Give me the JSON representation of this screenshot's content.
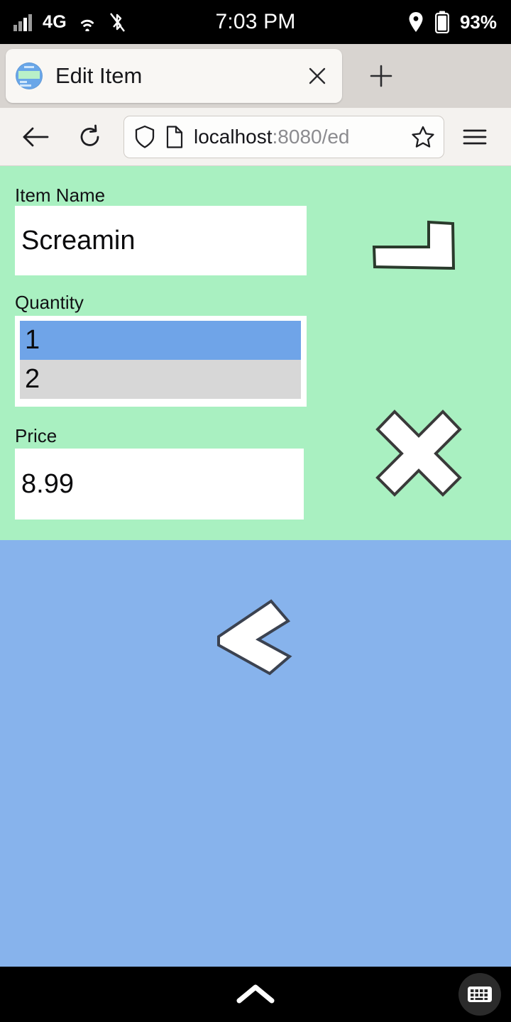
{
  "status_bar": {
    "network_label": "4G",
    "time": "7:03 PM",
    "battery_percent": "93%",
    "icons": [
      "signal-bars-icon",
      "wifi-icon",
      "bluetooth-off-icon",
      "location-pin-icon",
      "battery-icon"
    ]
  },
  "browser": {
    "tab": {
      "title": "Edit Item",
      "favicon": "page-thumbnail-favicon",
      "close_label": "×"
    },
    "new_tab_label": "+",
    "toolbar": {
      "back_icon": "arrow-left-icon",
      "reload_icon": "reload-icon",
      "shield_icon": "shield-icon",
      "page_icon": "page-document-icon",
      "bookmark_icon": "star-icon",
      "menu_icon": "hamburger-menu-icon"
    },
    "url": {
      "host": "localhost",
      "rest": ":8080/ed",
      "full_visible": "localhost:8080/ed"
    }
  },
  "page": {
    "background_top_color": "#a9f0c1",
    "background_bottom_color": "#87b3ec",
    "fields": [
      {
        "label": "Item Name",
        "value": "Screamin",
        "type": "text"
      },
      {
        "label": "Quantity",
        "value": "1",
        "type": "select"
      },
      {
        "label": "Price",
        "value": "8.99",
        "type": "text"
      }
    ],
    "quantity_options": [
      {
        "label": "1",
        "selected": true
      },
      {
        "label": "2",
        "selected": false
      }
    ],
    "shapes": [
      {
        "name": "l-block-shape",
        "fill": "#ffffff",
        "stroke": "#2a3a2c"
      },
      {
        "name": "cross-shape",
        "fill": "#ffffff",
        "stroke": "#3a3a3a"
      },
      {
        "name": "left-chevron-shape",
        "fill": "#ffffff",
        "stroke": "#3b4250"
      }
    ],
    "select_highlight_color": "#6fa4e8",
    "select_option_color": "#d7d7d7"
  },
  "navigation_bar": {
    "home_icon": "chevron-up-icon",
    "keyboard_icon": "keyboard-icon"
  }
}
